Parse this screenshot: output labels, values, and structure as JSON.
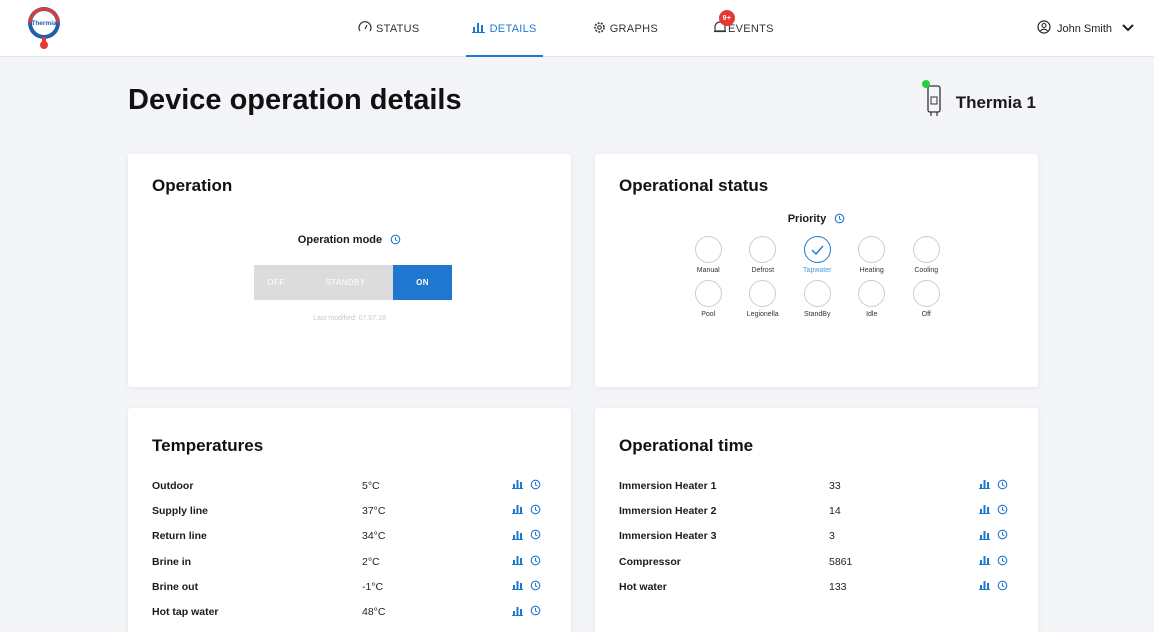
{
  "header": {
    "logo_text": "Thermia",
    "nav": [
      {
        "label": "STATUS",
        "icon": "gauge-icon"
      },
      {
        "label": "DETAILS",
        "icon": "bar-chart-icon",
        "active": true
      },
      {
        "label": "GRAPHS",
        "icon": "gear-icon"
      },
      {
        "label": "EVENTS",
        "icon": "bell-icon",
        "badge": "9+"
      }
    ],
    "user": {
      "name": "John Smith",
      "icon": "user-circle-icon"
    }
  },
  "page": {
    "title": "Device operation details",
    "device_name": "Thermia 1",
    "device_status_color": "#2ecc40"
  },
  "operation": {
    "title": "Operation",
    "mode_label": "Operation mode",
    "modes": [
      "OFF",
      "STANDBY",
      "ON"
    ],
    "selected_mode": "ON",
    "last_modified": "Last modified: 07.07.18"
  },
  "operational_status": {
    "title": "Operational status",
    "priority_label": "Priority",
    "options": [
      "Manual",
      "Defrost",
      "Tapwater",
      "Heating",
      "Cooling",
      "Pool",
      "Legionella",
      "StandBy",
      "Idle",
      "Off"
    ],
    "selected": "Tapwater"
  },
  "temperatures": {
    "title": "Temperatures",
    "rows": [
      {
        "name": "Outdoor",
        "value": "5°C"
      },
      {
        "name": "Supply line",
        "value": "37°C"
      },
      {
        "name": "Return line",
        "value": "34°C"
      },
      {
        "name": "Brine in",
        "value": "2°C"
      },
      {
        "name": "Brine out",
        "value": "-1°C"
      },
      {
        "name": "Hot tap water",
        "value": "48°C"
      }
    ]
  },
  "operational_time": {
    "title": "Operational time",
    "rows": [
      {
        "name": "Immersion Heater 1",
        "value": "33"
      },
      {
        "name": "Immersion Heater 2",
        "value": "14"
      },
      {
        "name": "Immersion Heater 3",
        "value": "3"
      },
      {
        "name": "Compressor",
        "value": "5861"
      },
      {
        "name": "Hot water",
        "value": "133"
      }
    ]
  },
  "colors": {
    "accent": "#1f77d0",
    "badge": "#e53935"
  }
}
